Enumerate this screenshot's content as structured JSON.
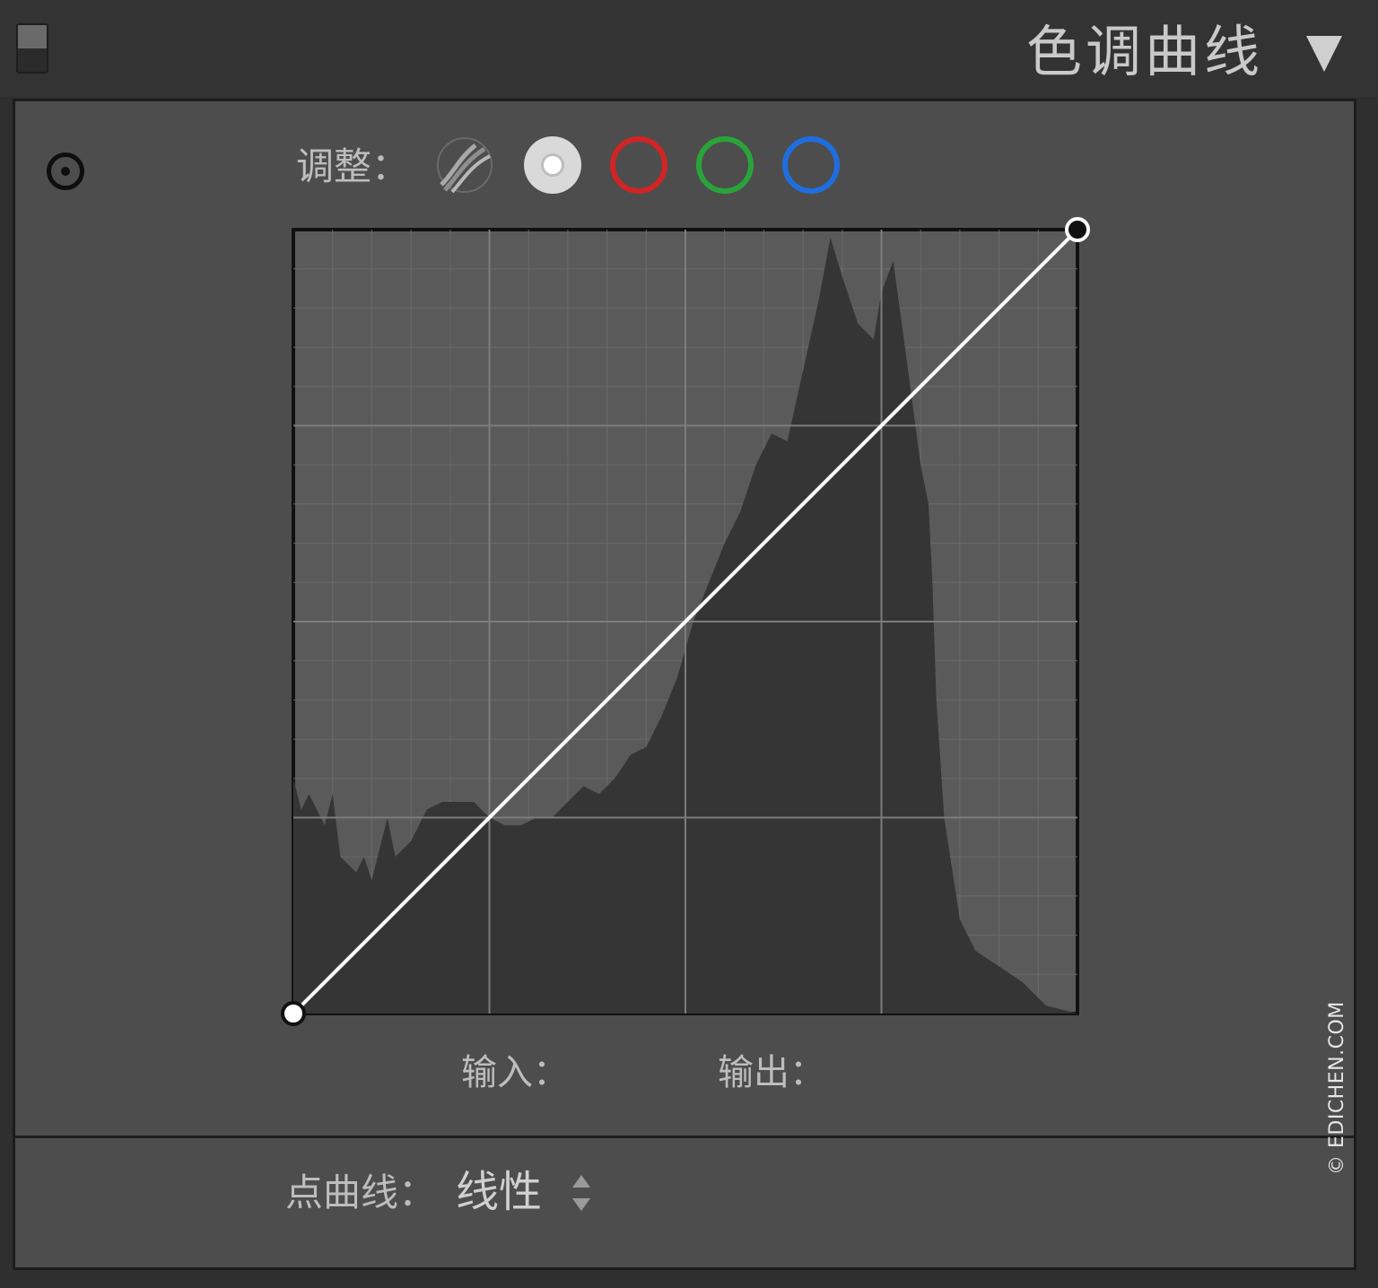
{
  "header": {
    "title": "色调曲线"
  },
  "adjust": {
    "label": "调整：",
    "channels": [
      {
        "name": "parametric",
        "color": "#9a9a9a"
      },
      {
        "name": "rgb",
        "color": "#d9d9d9",
        "selected": true
      },
      {
        "name": "red",
        "color": "#d12424"
      },
      {
        "name": "green",
        "color": "#2aa33a"
      },
      {
        "name": "blue",
        "color": "#1f6ee0"
      }
    ]
  },
  "curve": {
    "points": [
      {
        "input": 0,
        "output": 0
      },
      {
        "input": 255,
        "output": 255
      }
    ],
    "input_label": "输入：",
    "output_label": "输出："
  },
  "point_curve": {
    "label": "点曲线：",
    "value": "线性"
  },
  "watermark": "© EDICHEN.COM",
  "colors": {
    "panel_bg": "#4d4d4d",
    "header_bg": "#333333",
    "curve_line": "#ffffff",
    "histogram": "#353535"
  }
}
